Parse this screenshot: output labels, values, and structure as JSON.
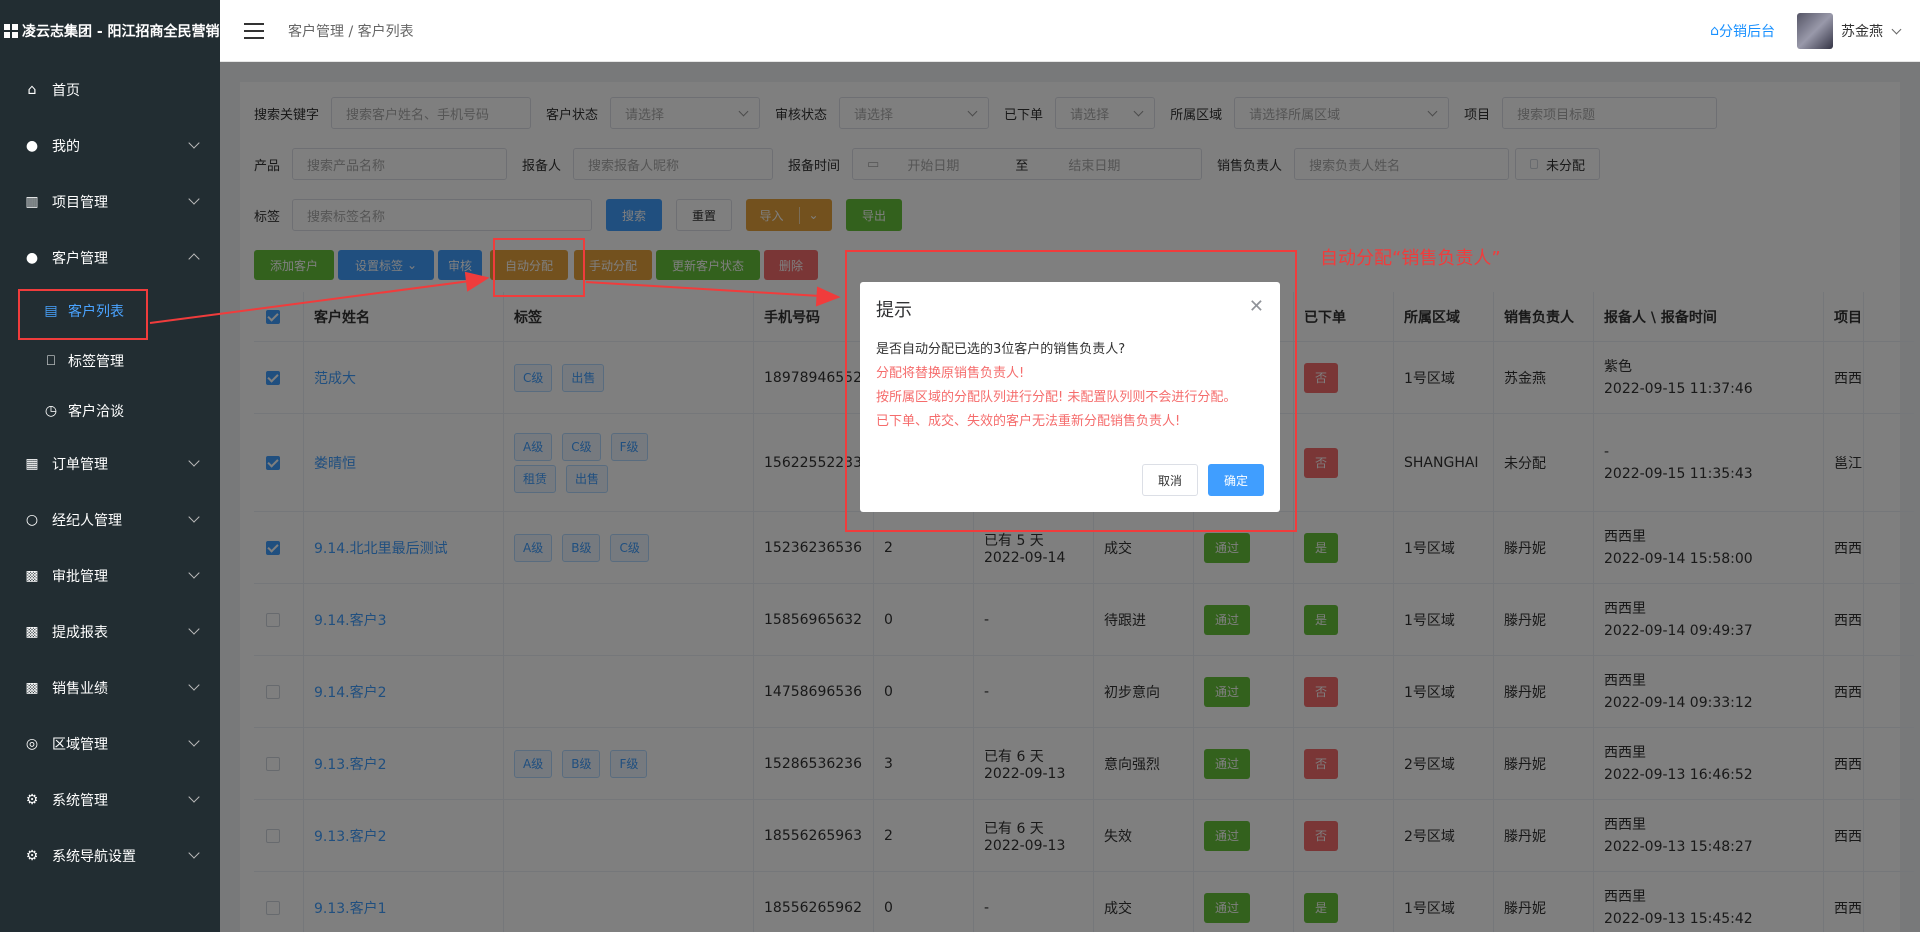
{
  "app": {
    "brand": "凌云志集团 - 阳江招商全民营销"
  },
  "sidebar": {
    "items": [
      {
        "label": "首页"
      },
      {
        "label": "我的"
      },
      {
        "label": "项目管理"
      },
      {
        "label": "客户管理"
      },
      {
        "label": "客户列表"
      },
      {
        "label": "标签管理"
      },
      {
        "label": "客户洽谈"
      },
      {
        "label": "订单管理"
      },
      {
        "label": "经纪人管理"
      },
      {
        "label": "审批管理"
      },
      {
        "label": "提成报表"
      },
      {
        "label": "销售业绩"
      },
      {
        "label": "区域管理"
      },
      {
        "label": "系统管理"
      },
      {
        "label": "系统导航设置"
      }
    ]
  },
  "header": {
    "breadcrumb": "客户管理 / 客户列表",
    "dist_link": "分销后台",
    "user_name": "苏金燕"
  },
  "filters": {
    "keyword_label": "搜索关键字",
    "keyword_placeholder": "搜索客户姓名、手机号码",
    "status_label": "客户状态",
    "status_placeholder": "请选择",
    "audit_label": "审核状态",
    "audit_placeholder": "请选择",
    "ordered_label": "已下单",
    "ordered_placeholder": "请选择",
    "region_label": "所属区域",
    "region_placeholder": "请选择所属区域",
    "project_label": "项目",
    "project_placeholder": "搜索项目标题",
    "product_label": "产品",
    "product_placeholder": "搜索产品名称",
    "reporter_label": "报备人",
    "reporter_placeholder": "搜索报备人昵称",
    "time_label": "报备时间",
    "start_placeholder": "开始日期",
    "to": "至",
    "end_placeholder": "结束日期",
    "sales_label": "销售负责人",
    "sales_placeholder": "搜索负责人姓名",
    "unassigned": "未分配",
    "tag_label": "标签",
    "tag_placeholder": "搜索标签名称",
    "search_btn": "搜索",
    "reset_btn": "重置",
    "import_btn": "导入",
    "export_btn": "导出"
  },
  "actions": {
    "add": "添加客户",
    "set_tag": "设置标签",
    "audit": "审核",
    "auto_assign": "自动分配",
    "manual_assign": "手动分配",
    "update_status": "更新客户状态",
    "delete": "删除"
  },
  "table": {
    "headers": [
      "客户姓名",
      "标签",
      "手机号码",
      "已下单",
      "所属区域",
      "销售负责人",
      "报备人 \\ 报备时间",
      "项目"
    ],
    "rows": [
      {
        "checked": true,
        "name": "范成大",
        "tags": [
          "C级",
          "出售"
        ],
        "phone": "18978946552",
        "visits": "",
        "follow": "",
        "follow2": "",
        "status": "",
        "audit": "",
        "ordered": "否",
        "region": "1号区域",
        "sales": "苏金燕",
        "reporter": "紫色",
        "time": "2022-09-15 11:37:46",
        "project": "西西"
      },
      {
        "checked": true,
        "name": "娄晴恒",
        "tags": [
          "A级",
          "C级",
          "F级",
          "租赁",
          "出售"
        ],
        "phone": "15622552233",
        "visits": "",
        "follow": "",
        "follow2": "",
        "status": "",
        "audit": "",
        "ordered": "否",
        "region": "SHANGHAI",
        "sales": "未分配",
        "reporter": "-",
        "time": "2022-09-15 11:35:43",
        "project": "邕江"
      },
      {
        "checked": true,
        "name": "9.14.北北里最后测试",
        "tags": [
          "A级",
          "B级",
          "C级"
        ],
        "phone": "15236236536",
        "visits": "2",
        "follow": "已有 5 天",
        "follow2": "2022-09-14",
        "status": "成交",
        "audit": "通过",
        "ordered": "是",
        "region": "1号区域",
        "sales": "滕丹妮",
        "reporter": "西西里",
        "time": "2022-09-14 15:58:00",
        "project": "西西"
      },
      {
        "checked": false,
        "name": "9.14.客户3",
        "tags": [],
        "phone": "15856965632",
        "visits": "0",
        "follow": "-",
        "follow2": "",
        "status": "待跟进",
        "audit": "通过",
        "ordered": "是",
        "region": "1号区域",
        "sales": "滕丹妮",
        "reporter": "西西里",
        "time": "2022-09-14 09:49:37",
        "project": "西西"
      },
      {
        "checked": false,
        "name": "9.14.客户2",
        "tags": [],
        "phone": "14758696536",
        "visits": "0",
        "follow": "-",
        "follow2": "",
        "status": "初步意向",
        "audit": "通过",
        "ordered": "否",
        "region": "1号区域",
        "sales": "滕丹妮",
        "reporter": "西西里",
        "time": "2022-09-14 09:33:12",
        "project": "西西"
      },
      {
        "checked": false,
        "name": "9.13.客户2",
        "tags": [
          "A级",
          "B级",
          "F级"
        ],
        "phone": "15286536236",
        "visits": "3",
        "follow": "已有 6 天",
        "follow2": "2022-09-13",
        "status": "意向强烈",
        "audit": "通过",
        "ordered": "否",
        "region": "2号区域",
        "sales": "滕丹妮",
        "reporter": "西西里",
        "time": "2022-09-13 16:46:52",
        "project": "西西"
      },
      {
        "checked": false,
        "name": "9.13.客户2",
        "tags": [],
        "phone": "18556265963",
        "visits": "2",
        "follow": "已有 6 天",
        "follow2": "2022-09-13",
        "status": "失效",
        "audit": "通过",
        "ordered": "否",
        "region": "2号区域",
        "sales": "滕丹妮",
        "reporter": "西西里",
        "time": "2022-09-13 15:48:27",
        "project": "西西"
      },
      {
        "checked": false,
        "name": "9.13.客户1",
        "tags": [],
        "phone": "18556265962",
        "visits": "0",
        "follow": "-",
        "follow2": "",
        "status": "成交",
        "audit": "通过",
        "ordered": "是",
        "region": "1号区域",
        "sales": "滕丹妮",
        "reporter": "西西里",
        "time": "2022-09-13 15:45:42",
        "project": "西西"
      }
    ]
  },
  "dialog": {
    "title": "提示",
    "question": "是否自动分配已选的3位客户的销售负责人?",
    "warn1": "分配将替换原销售负责人!",
    "warn2": "按所属区域的分配队列进行分配! 未配置队列则不会进行分配。",
    "warn3": "已下单、成交、失效的客户无法重新分配销售负责人!",
    "cancel": "取消",
    "confirm": "确定"
  },
  "annotation": {
    "text": "自动分配“销售负责人”"
  },
  "colors": {
    "sidebar_bg": "#222d32",
    "primary": "#409eff",
    "success": "#67c23a",
    "danger": "#f56c6c",
    "annotation": "#f03c3c"
  }
}
